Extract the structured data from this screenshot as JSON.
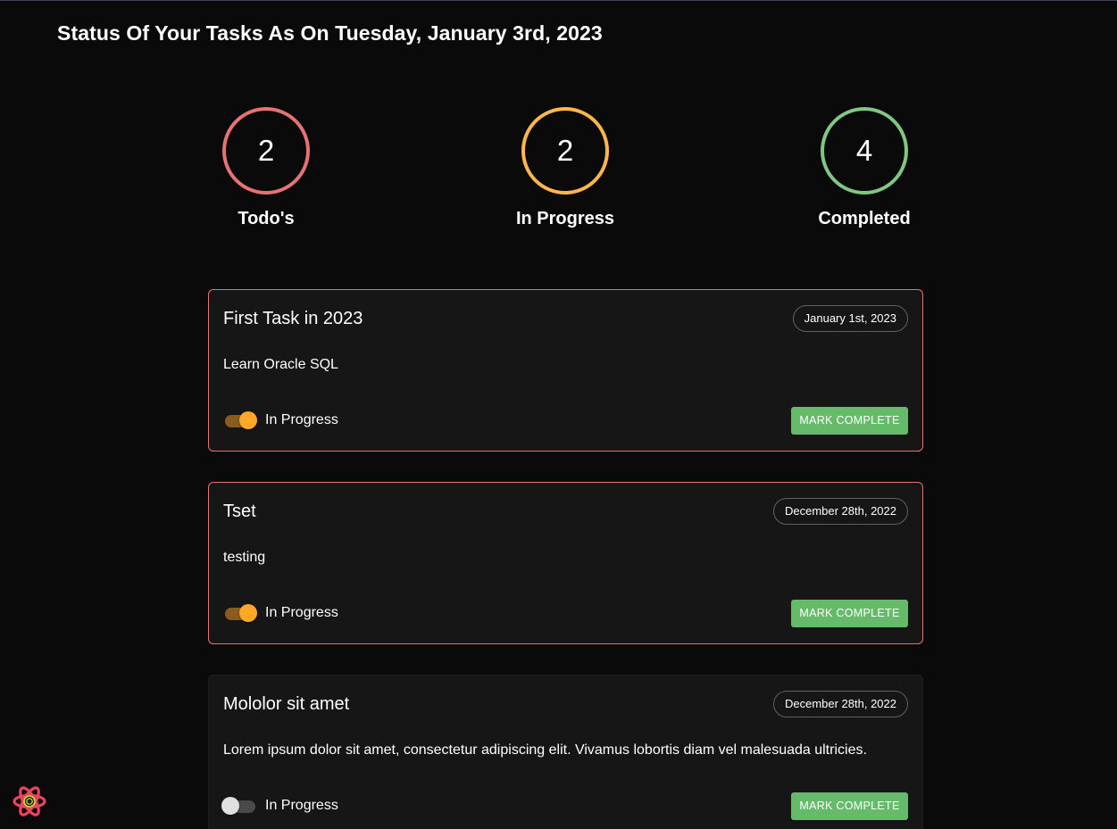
{
  "header": {
    "title": "Status Of Your Tasks As On Tuesday, January 3rd, 2023"
  },
  "stats": [
    {
      "count": "2",
      "label": "Todo's",
      "color": "#e57373"
    },
    {
      "count": "2",
      "label": "In Progress",
      "color": "#ffb74d"
    },
    {
      "count": "4",
      "label": "Completed",
      "color": "#81c784"
    }
  ],
  "tasks": [
    {
      "title": "First Task in 2023",
      "date": "January 1st, 2023",
      "description": "Learn Oracle SQL",
      "toggle_label": "In Progress",
      "in_progress": true,
      "button_label": "MARK COMPLETE"
    },
    {
      "title": "Tset",
      "date": "December 28th, 2022",
      "description": "testing",
      "toggle_label": "In Progress",
      "in_progress": true,
      "button_label": "MARK COMPLETE"
    },
    {
      "title": "Mololor sit amet",
      "date": "December 28th, 2022",
      "description": "Lorem ipsum dolor sit amet, consectetur adipiscing elit. Vivamus lobortis diam vel malesuada ultricies.",
      "toggle_label": "In Progress",
      "in_progress": false,
      "button_label": "MARK COMPLETE"
    }
  ],
  "theme": {
    "background": "#0a0a0a",
    "card_background": "#161616",
    "todo_border": "#e57373",
    "toggle_on": "#ffa726",
    "button_green": "#66bb6a"
  },
  "icons": {
    "devtools": "react-devtools-icon"
  }
}
